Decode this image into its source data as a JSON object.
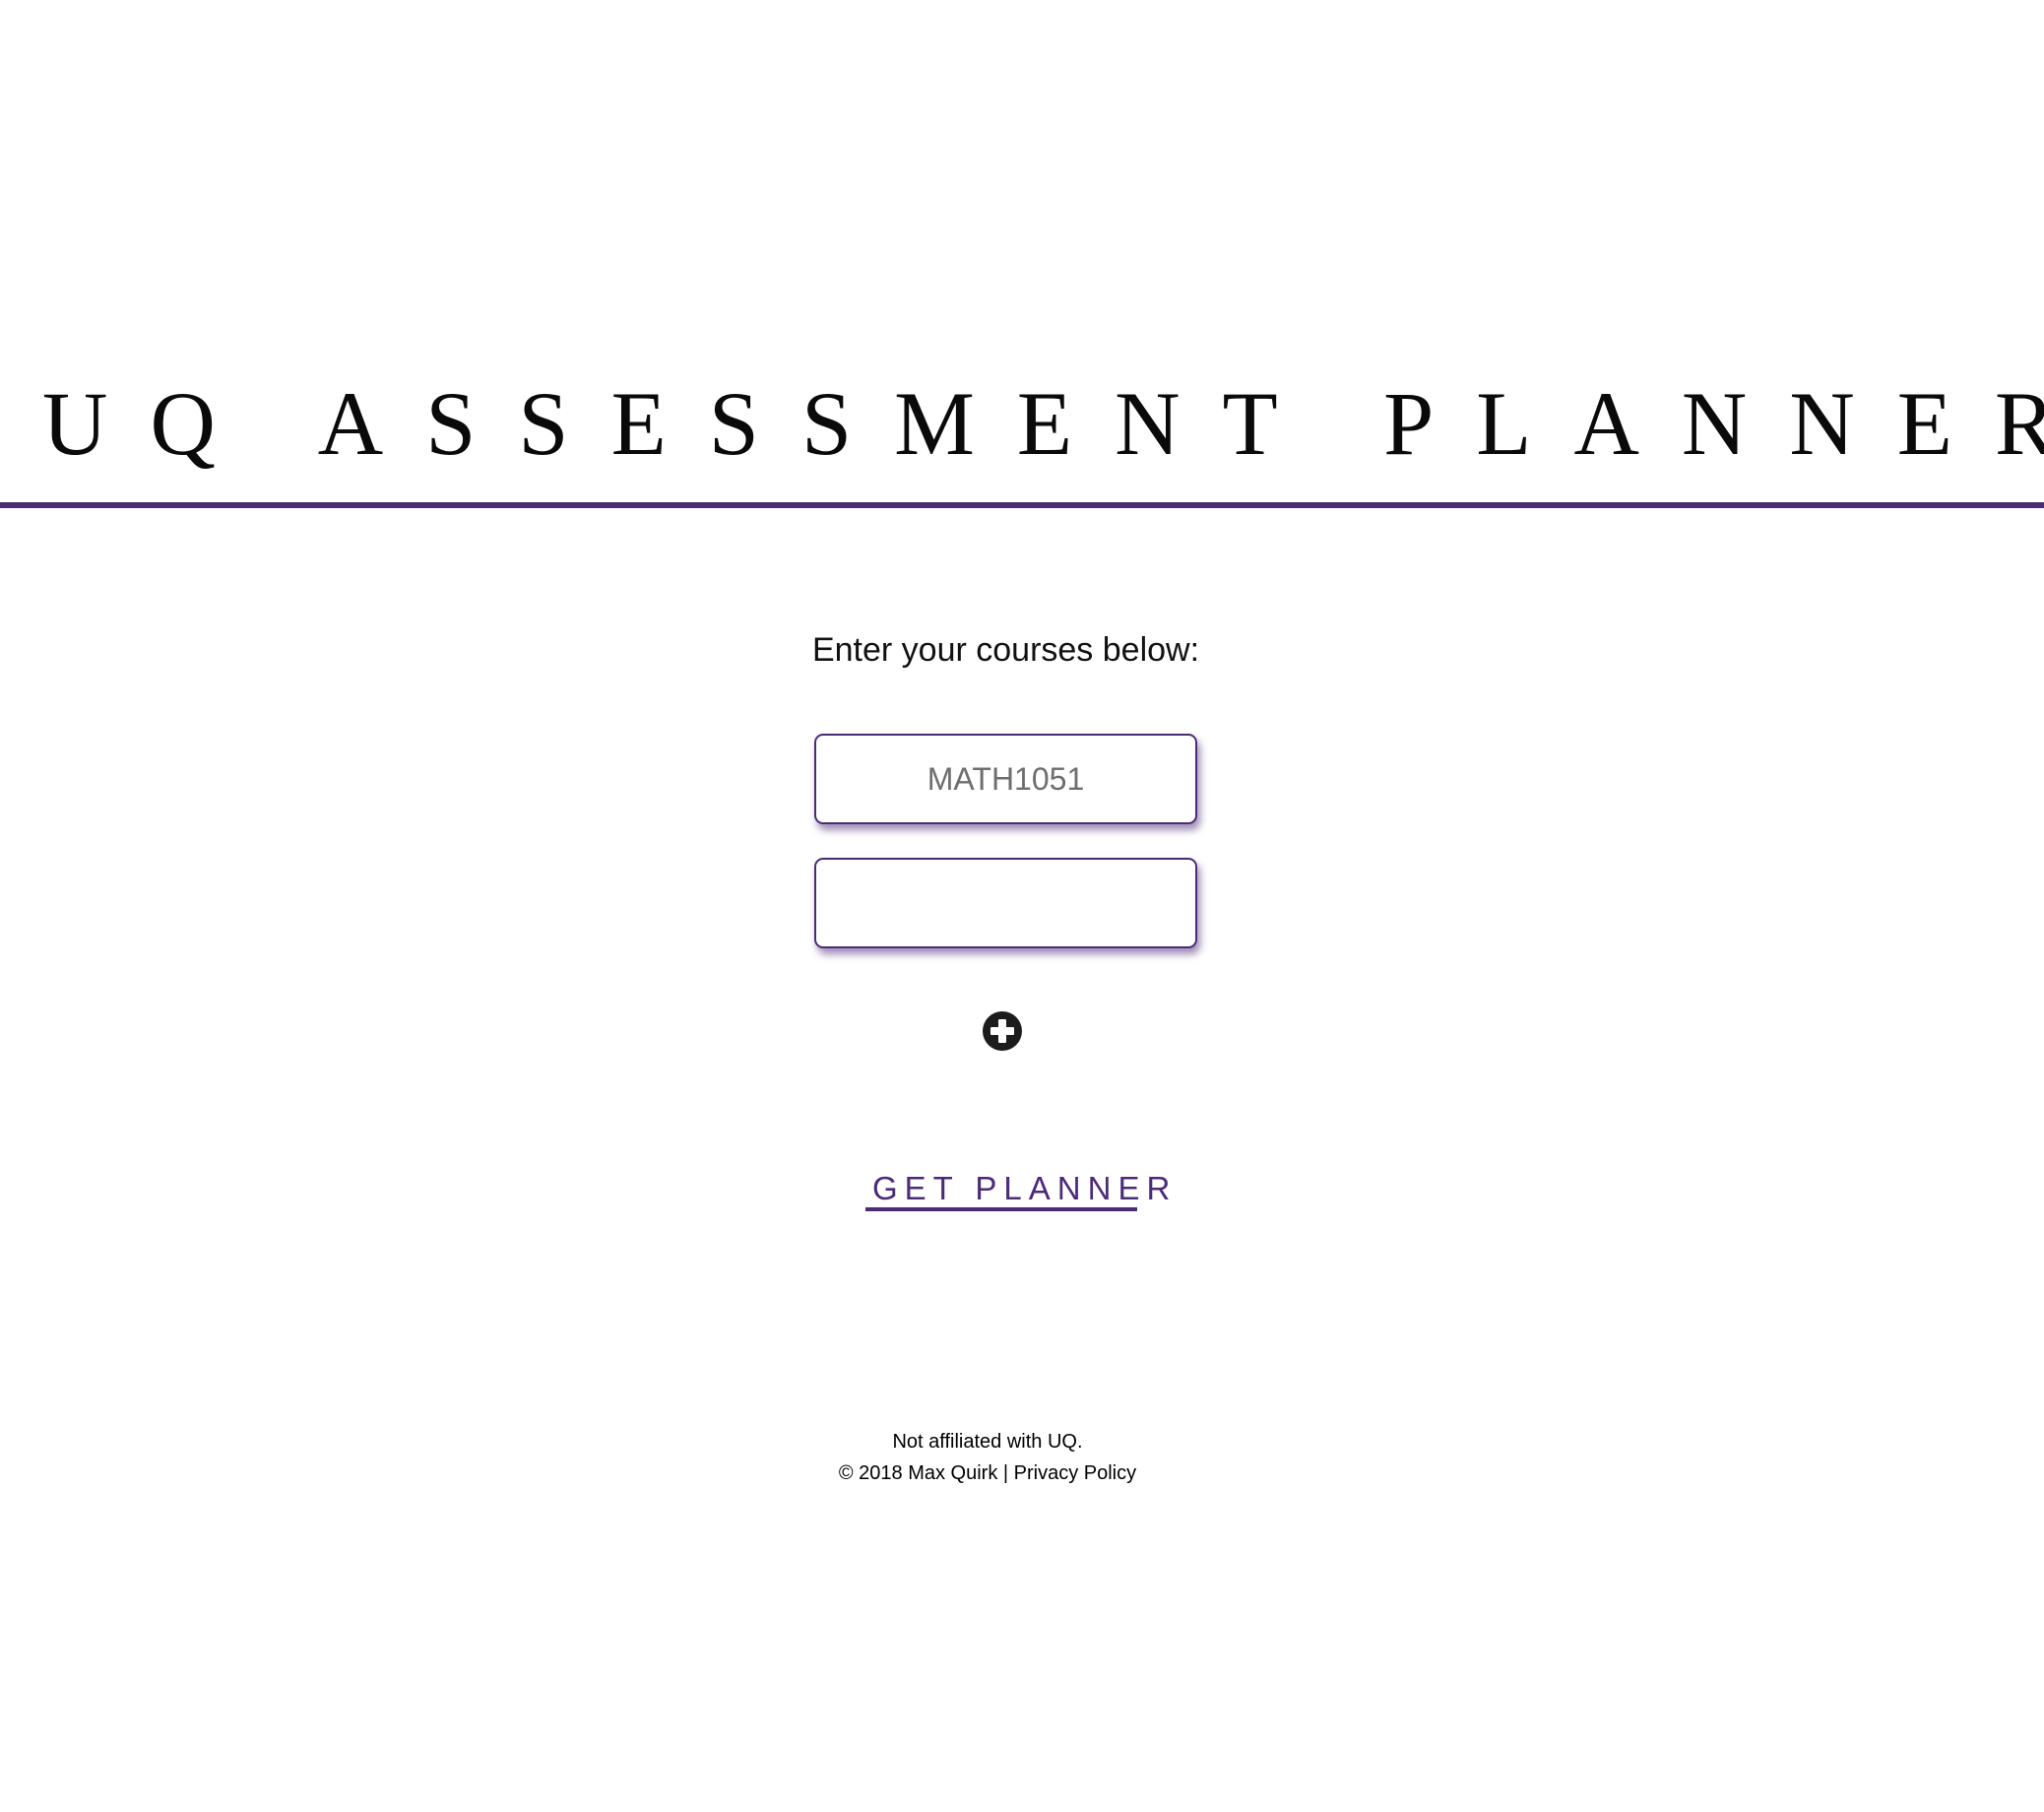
{
  "header": {
    "title": "UQ ASSESSMENT PLANNER"
  },
  "main": {
    "prompt": "Enter your courses below:",
    "course_fields": [
      {
        "value": "",
        "placeholder": "MATH1051"
      },
      {
        "value": "",
        "placeholder": ""
      }
    ],
    "add_icon": "plus-circle-icon",
    "submit_label": "GET PLANNER"
  },
  "footer": {
    "disclaimer": "Not affiliated with UQ.",
    "copyright": "© 2018 Max Quirk",
    "separator": "|",
    "privacy_link": "Privacy Policy"
  },
  "colors": {
    "accent": "#4b2b77",
    "text": "#000000",
    "background": "#ffffff"
  }
}
